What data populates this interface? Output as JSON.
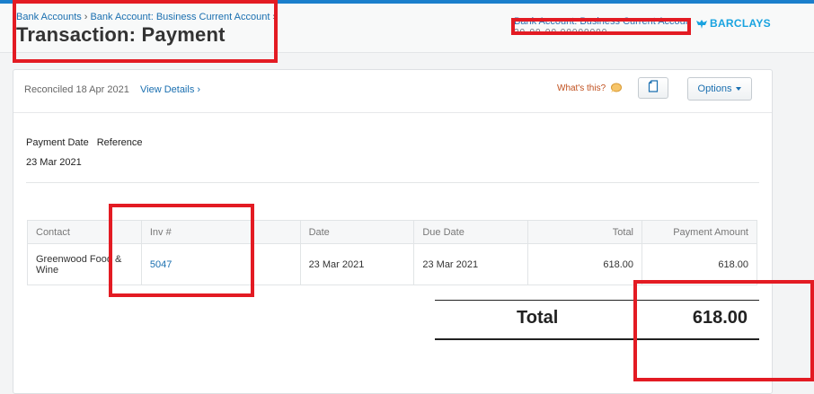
{
  "header": {
    "breadcrumb": [
      "Bank Accounts",
      "Bank Account: Business Current Account"
    ],
    "title": "Transaction: Payment",
    "account_name": "Bank Account: Business Current Account",
    "account_number": "20-00-00 00000000",
    "bank_logo_text": "BARCLAYS"
  },
  "toolbar": {
    "reconciled": "Reconciled 18 Apr 2021",
    "view_details": "View Details ›",
    "whats_this": "What's this?",
    "options": "Options"
  },
  "details": {
    "payment_date_label": "Payment Date",
    "reference_label": "Reference",
    "payment_date": "23 Mar 2021"
  },
  "table": {
    "columns": [
      "Contact",
      "Inv #",
      "Date",
      "Due Date",
      "Total",
      "Payment Amount"
    ],
    "rows": [
      {
        "contact": "Greenwood Food & Wine",
        "invoice": "5047",
        "date": "23 Mar 2021",
        "due_date": "23 Mar 2021",
        "total": "618.00",
        "payment_amount": "618.00"
      }
    ]
  },
  "totals": {
    "label": "Total",
    "value": "618.00"
  },
  "colors": {
    "accent": "#1b7fcc",
    "link": "#1a6fb0",
    "annotation": "#e31b23"
  },
  "icons": [
    "eagle-icon",
    "help-bubble-icon",
    "document-icon",
    "chevron-down-icon"
  ]
}
